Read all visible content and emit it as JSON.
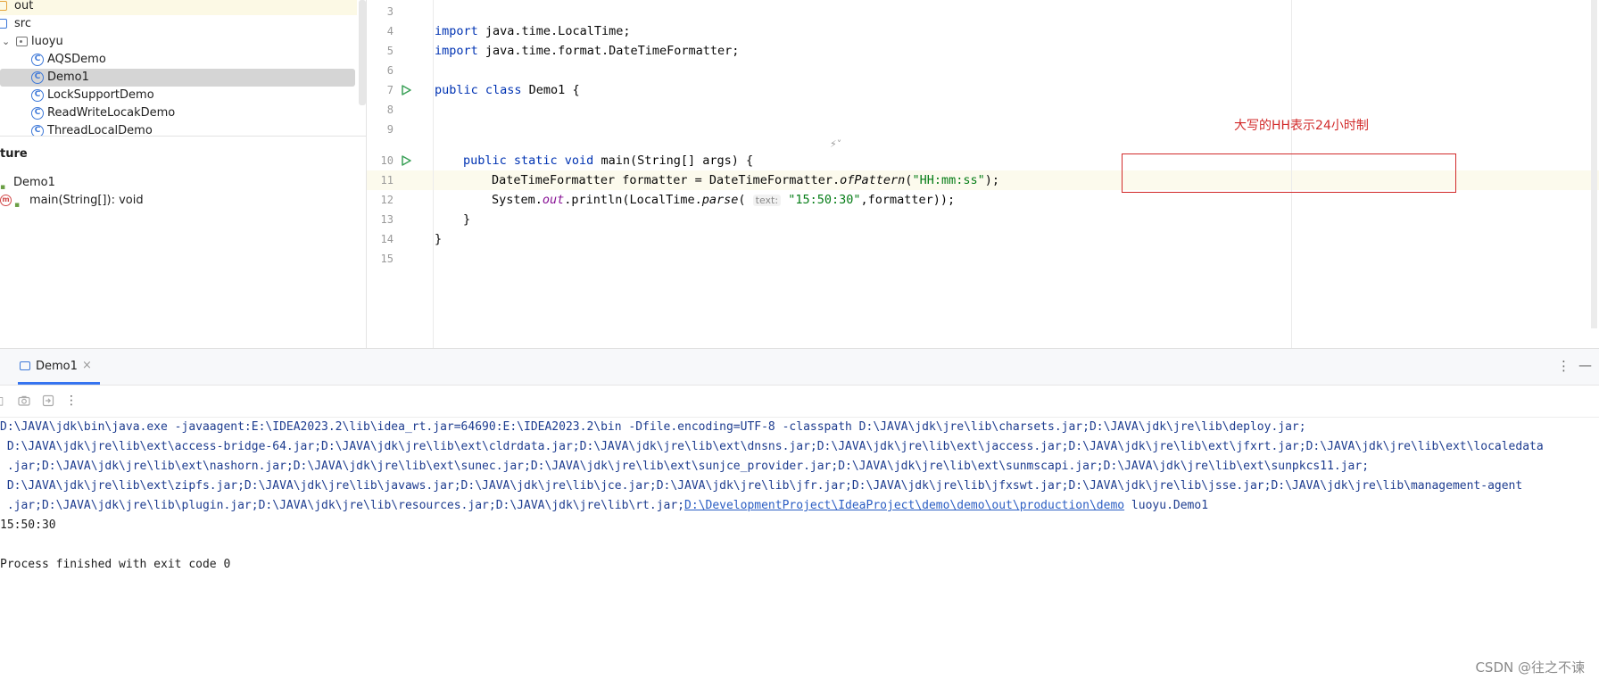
{
  "project_tree": {
    "items": [
      {
        "label": "out",
        "icon": "folder-icon"
      },
      {
        "label": "src",
        "icon": "folder-icon"
      },
      {
        "label": "luoyu",
        "icon": "package-icon"
      },
      {
        "label": "AQSDemo",
        "icon": "class-icon"
      },
      {
        "label": "Demo1",
        "icon": "class-icon"
      },
      {
        "label": "LockSupportDemo",
        "icon": "class-icon"
      },
      {
        "label": "ReadWriteLocakDemo",
        "icon": "class-icon"
      },
      {
        "label": "ThreadLocalDemo",
        "icon": "class-icon"
      }
    ],
    "class_icon_glyph": "C"
  },
  "structure": {
    "title": "ture",
    "items": [
      {
        "label": "Demo1"
      },
      {
        "label": "main(String[]): void",
        "icon_glyph": "m"
      }
    ]
  },
  "editor": {
    "line_numbers": [
      "3",
      "4",
      "5",
      "6",
      "7",
      "8",
      "9",
      "10",
      "11",
      "12",
      "13",
      "14",
      "15"
    ],
    "code": {
      "l4_kw": "import",
      "l4_rest": " java.time.LocalTime;",
      "l5_kw": "import",
      "l5_rest": " java.time.format.DateTimeFormatter;",
      "l7_kw": "public class",
      "l7_rest": " Demo1 {",
      "l10_kw": "public static void",
      "l10_rest": " main(String[] args) {",
      "l11_a": "DateTimeFormatter formatter = DateTimeFormatter.",
      "l11_method": "ofPattern",
      "l11_b": "(",
      "l11_str": "\"HH:mm:ss\"",
      "l11_c": ");",
      "l12_a": "System.",
      "l12_field": "out",
      "l12_b": ".println(LocalTime.",
      "l12_method": "parse",
      "l12_c": "( ",
      "l12_hint": "text:",
      "l12_str": " \"15:50:30\"",
      "l12_d": ",formatter));",
      "l13": "}",
      "l14": "}"
    },
    "annotation": "大写的HH表示24小时制",
    "lens_glyph": "⚡︎˅"
  },
  "run_window": {
    "tab_label": "Demo1",
    "tab_close": "×",
    "more_glyph": "⋮",
    "minimize_glyph": "—",
    "console_lines": [
      "D:\\JAVA\\jdk\\bin\\java.exe -javaagent:E:\\IDEA2023.2\\lib\\idea_rt.jar=64690:E:\\IDEA2023.2\\bin -Dfile.encoding=UTF-8 -classpath D:\\JAVA\\jdk\\jre\\lib\\charsets.jar;D:\\JAVA\\jdk\\jre\\lib\\deploy.jar;",
      " D:\\JAVA\\jdk\\jre\\lib\\ext\\access-bridge-64.jar;D:\\JAVA\\jdk\\jre\\lib\\ext\\cldrdata.jar;D:\\JAVA\\jdk\\jre\\lib\\ext\\dnsns.jar;D:\\JAVA\\jdk\\jre\\lib\\ext\\jaccess.jar;D:\\JAVA\\jdk\\jre\\lib\\ext\\jfxrt.jar;D:\\JAVA\\jdk\\jre\\lib\\ext\\localedata",
      " .jar;D:\\JAVA\\jdk\\jre\\lib\\ext\\nashorn.jar;D:\\JAVA\\jdk\\jre\\lib\\ext\\sunec.jar;D:\\JAVA\\jdk\\jre\\lib\\ext\\sunjce_provider.jar;D:\\JAVA\\jdk\\jre\\lib\\ext\\sunmscapi.jar;D:\\JAVA\\jdk\\jre\\lib\\ext\\sunpkcs11.jar;",
      " D:\\JAVA\\jdk\\jre\\lib\\ext\\zipfs.jar;D:\\JAVA\\jdk\\jre\\lib\\javaws.jar;D:\\JAVA\\jdk\\jre\\lib\\jce.jar;D:\\JAVA\\jdk\\jre\\lib\\jfr.jar;D:\\JAVA\\jdk\\jre\\lib\\jfxswt.jar;D:\\JAVA\\jdk\\jre\\lib\\jsse.jar;D:\\JAVA\\jdk\\jre\\lib\\management-agent"
    ],
    "console_line5_prefix": " .jar;D:\\JAVA\\jdk\\jre\\lib\\plugin.jar;D:\\JAVA\\jdk\\jre\\lib\\resources.jar;D:\\JAVA\\jdk\\jre\\lib\\rt.jar;",
    "console_line5_link": "D:\\DevelopmentProject\\IdeaProject\\demo\\demo\\out\\production\\demo",
    "console_line5_suffix": " luoyu.Demo1",
    "output": "15:50:30",
    "exit_message": "Process finished with exit code 0"
  },
  "watermark": "CSDN @往之不谏",
  "colors": {
    "keyword": "#0033b3",
    "string": "#067d17",
    "annotation": "#d22b2b",
    "selection": "#d5d5d5",
    "accent": "#3574f0"
  }
}
